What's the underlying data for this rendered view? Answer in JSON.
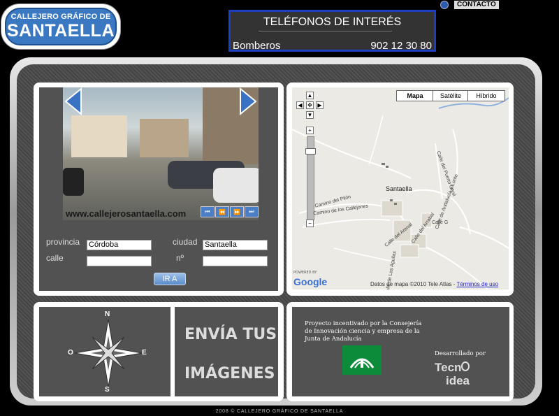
{
  "logo": {
    "top": "CALLEJERO GRÁFICO DE",
    "main": "SANTAELLA"
  },
  "phones": {
    "title": "TELÉFONOS DE INTERÉS",
    "entry_name": "Bomberos",
    "entry_number": "902 12 30 80"
  },
  "contact": {
    "label": "CONTACTO"
  },
  "photo": {
    "url_text": "www.callejerosantaella.com",
    "nav_icons": [
      "prev-arrow-icon",
      "next-arrow-icon"
    ],
    "buttons": [
      "⏮",
      "⏪",
      "⏩",
      "⏭"
    ]
  },
  "form": {
    "provincia_label": "provincia",
    "provincia_value": "Córdoba",
    "ciudad_label": "ciudad",
    "ciudad_value": "Santaella",
    "calle_label": "calle",
    "calle_value": "",
    "numero_label": "nº",
    "numero_value": "",
    "go_label": "IR A"
  },
  "map": {
    "types": [
      "Mapa",
      "Satélite",
      "Híbrido"
    ],
    "selected_type": "Mapa",
    "town": "Santaella",
    "streets": [
      "Camino del Pilón",
      "Camino de los Callejones",
      "Calle del Arenal",
      "Calle de Las Aguilas",
      "Calle G",
      "Calle del Puerto Genil",
      "Calle del Arrabal",
      "Calle de Andalucía y Lorite"
    ],
    "powered_by": "POWERED BY",
    "brand": "Google",
    "attribution": "Datos de mapa ©2010 Tele Atlas - ",
    "terms": "Términos de uso"
  },
  "compass": {
    "n": "N",
    "s": "S",
    "e": "E",
    "o": "O"
  },
  "envia": {
    "line1": "ENVÍA TUS",
    "line2": "IMÁGENES"
  },
  "info": {
    "text": "Proyecto incentivado por la Consejería de Innovación ciencia y empresa de la Junta de Andalucía",
    "developer_label": "Desarrollado por",
    "developer_line1": "Tecn",
    "developer_line2": "idea"
  },
  "footer": {
    "text": "2008 © CALLEJERO GRÁFICO DE SANTAELLA"
  },
  "colors": {
    "frame_dark": "#4a4a4a",
    "accent_blue": "#1a3fc0",
    "logo_blue": "#3a78c2",
    "junta_green": "#0c8b3a"
  }
}
